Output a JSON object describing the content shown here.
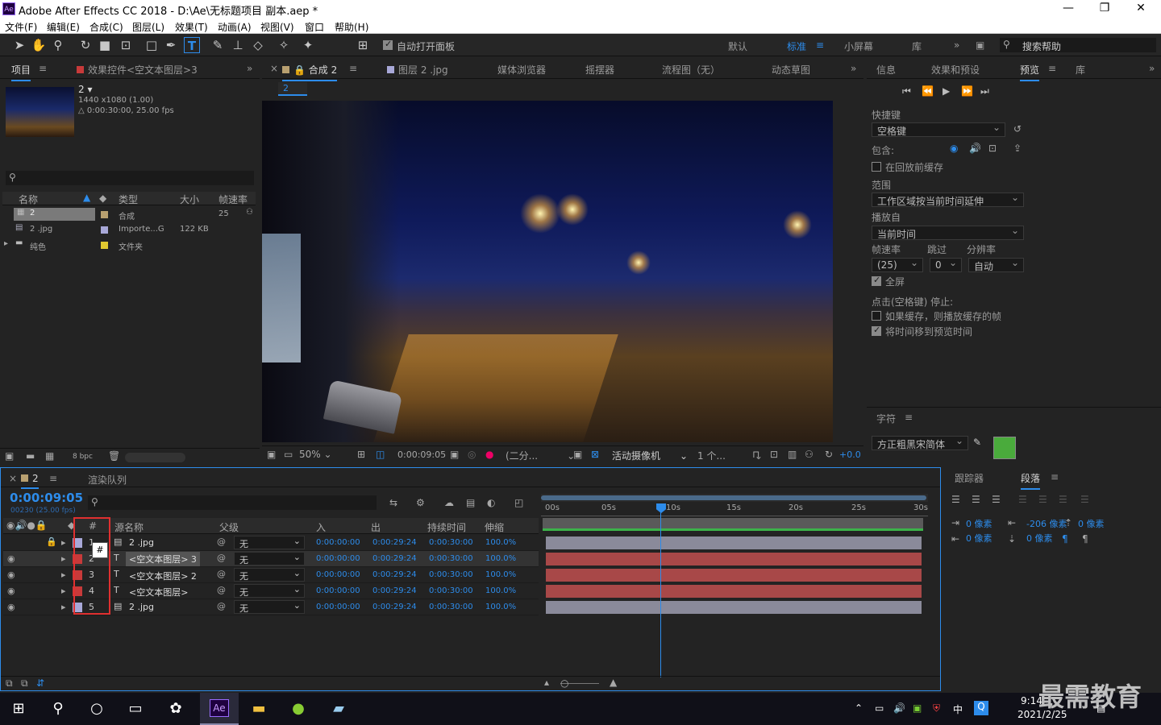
{
  "app": {
    "title": "Adobe After Effects CC 2018 - D:\\Ae\\无标题项目 副本.aep *",
    "icon_label": "Ae",
    "min": "—",
    "max": "❐",
    "close": "✕"
  },
  "menu": [
    "文件(F)",
    "编辑(E)",
    "合成(C)",
    "图层(L)",
    "效果(T)",
    "动画(A)",
    "视图(V)",
    "窗口",
    "帮助(H)"
  ],
  "toolbar": {
    "auto_open": "自动打开面板",
    "workspaces": [
      "默认",
      "标准",
      "小屏幕",
      "库"
    ],
    "search": "搜索帮助"
  },
  "project": {
    "tab": "项目",
    "tab2": "效果控件<空文本图层>3",
    "comp_name": "2",
    "comp_info1": "1440 x1080 (1.00)",
    "comp_info2": "△ 0:00:30:00, 25.00 fps",
    "cols": [
      "名称",
      "类型",
      "大小",
      "帧速率"
    ],
    "rows": [
      {
        "name": "2",
        "type": "合成",
        "size": "",
        "fps": "25"
      },
      {
        "name": "2 .jpg",
        "type": "Importe...G",
        "size": "122 KB",
        "fps": ""
      },
      {
        "name": "纯色",
        "type": "文件夹",
        "size": "",
        "fps": ""
      }
    ],
    "bpc": "8 bpc"
  },
  "viewer": {
    "tabs": [
      "合成 2",
      "图层 2 .jpg",
      "媒体浏览器",
      "摇摆器",
      "流程图（无）",
      "动态草图"
    ],
    "crumb": "2",
    "zoom": "50%",
    "time": "0:00:09:05",
    "res": "(二分...",
    "camera": "活动摄像机",
    "views": "1 个...",
    "exposure": "+0.0"
  },
  "right": {
    "tabs": [
      "信息",
      "效果和预设",
      "预览",
      "库"
    ],
    "shortcut_label": "快捷键",
    "shortcut": "空格键",
    "include": "包含:",
    "cache_before": "在回放前缓存",
    "range_label": "范围",
    "range": "工作区域按当前时间延伸",
    "play_from_label": "播放自",
    "play_from": "当前时间",
    "fps_label": "帧速率",
    "skip_label": "跳过",
    "res_label": "分辨率",
    "fps": "(25)",
    "skip": "0",
    "res": "自动",
    "fullscreen": "全屏",
    "stop_label": "点击(空格键) 停止:",
    "stop_opt1": "如果缓存，则播放缓存的帧",
    "stop_opt2": "将时间移到预览时间"
  },
  "char": {
    "tab": "字符",
    "font": "方正粗黑宋简体",
    "fill": "#4aab3c"
  },
  "para": {
    "tabs": [
      "跟踪器",
      "段落"
    ],
    "v1": "0 像素",
    "v2": "-206 像素",
    "v3": "0 像素",
    "v4": "0 像素",
    "v5": "0 像素"
  },
  "timeline": {
    "tab": "2",
    "tab2": "渲染队列",
    "time": "0:00:09:05",
    "frames": "00230 (25.00 fps)",
    "cols": [
      "#",
      "源名称",
      "父级",
      "入",
      "出",
      "持续时间",
      "伸缩"
    ],
    "ticks": [
      "00s",
      "05s",
      "10s",
      "15s",
      "20s",
      "25s",
      "30s"
    ],
    "layers": [
      {
        "num": "1",
        "name": "2 .jpg",
        "type": "img",
        "parent": "无",
        "in": "0:00:00:00",
        "out": "0:00:29:24",
        "dur": "0:00:30:00",
        "str": "100.0%"
      },
      {
        "num": "2",
        "name": "<空文本图层> 3",
        "type": "T",
        "parent": "无",
        "in": "0:00:00:00",
        "out": "0:00:29:24",
        "dur": "0:00:30:00",
        "str": "100.0%"
      },
      {
        "num": "3",
        "name": "<空文本图层> 2",
        "type": "T",
        "parent": "无",
        "in": "0:00:00:00",
        "out": "0:00:29:24",
        "dur": "0:00:30:00",
        "str": "100.0%"
      },
      {
        "num": "4",
        "name": "<空文本图层>",
        "type": "T",
        "parent": "无",
        "in": "0:00:00:00",
        "out": "0:00:29:24",
        "dur": "0:00:30:00",
        "str": "100.0%"
      },
      {
        "num": "5",
        "name": "2 .jpg",
        "type": "img",
        "parent": "无",
        "in": "0:00:00:00",
        "out": "0:00:29:24",
        "dur": "0:00:30:00",
        "str": "100.0%"
      }
    ],
    "tooltip": "#"
  },
  "taskbar": {
    "time": "9:14",
    "date": "2021/2/25",
    "ime": "中",
    "watermark": "最需教育"
  }
}
